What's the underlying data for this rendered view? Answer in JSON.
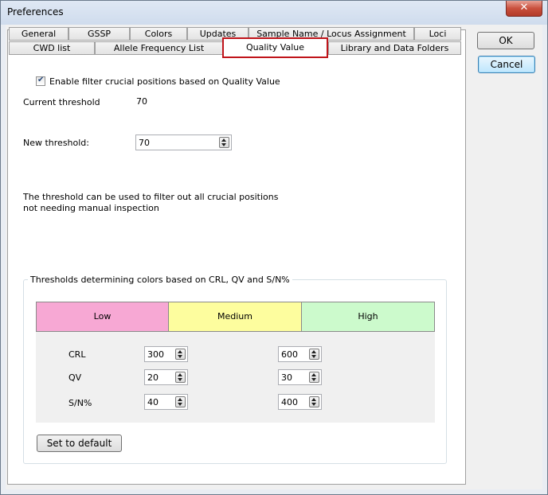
{
  "window": {
    "title": "Preferences",
    "close_glyph": "✕"
  },
  "tabs": {
    "row1": [
      "General",
      "GSSP",
      "Colors",
      "Updates",
      "Sample Name / Locus Assignment",
      "Loci"
    ],
    "row2": [
      "CWD list",
      "Allele Frequency List",
      "Quality Value",
      "Library and Data Folders"
    ],
    "active": "Quality Value"
  },
  "buttons": {
    "ok": "OK",
    "cancel": "Cancel",
    "set_default": "Set to default"
  },
  "quality": {
    "enable_label": "Enable filter crucial positions based on Quality Value",
    "enable_checked": true,
    "current_label": "Current threshold",
    "current_value": "70",
    "new_label": "New threshold:",
    "new_value": "70",
    "description_line1": "The threshold can be used to filter out all crucial positions",
    "description_line2": "not needing manual inspection"
  },
  "color_thresholds": {
    "group_title": "Thresholds determining colors based on CRL, QV and S/N%",
    "levels": [
      {
        "name": "Low",
        "color": "#f7a8d4"
      },
      {
        "name": "Medium",
        "color": "#fdfd9e"
      },
      {
        "name": "High",
        "color": "#ccfacc"
      }
    ],
    "rows": [
      {
        "label": "CRL",
        "low_medium": "300",
        "medium_high": "600"
      },
      {
        "label": "QV",
        "low_medium": "20",
        "medium_high": "30"
      },
      {
        "label": "S/N%",
        "low_medium": "40",
        "medium_high": "400"
      }
    ]
  }
}
